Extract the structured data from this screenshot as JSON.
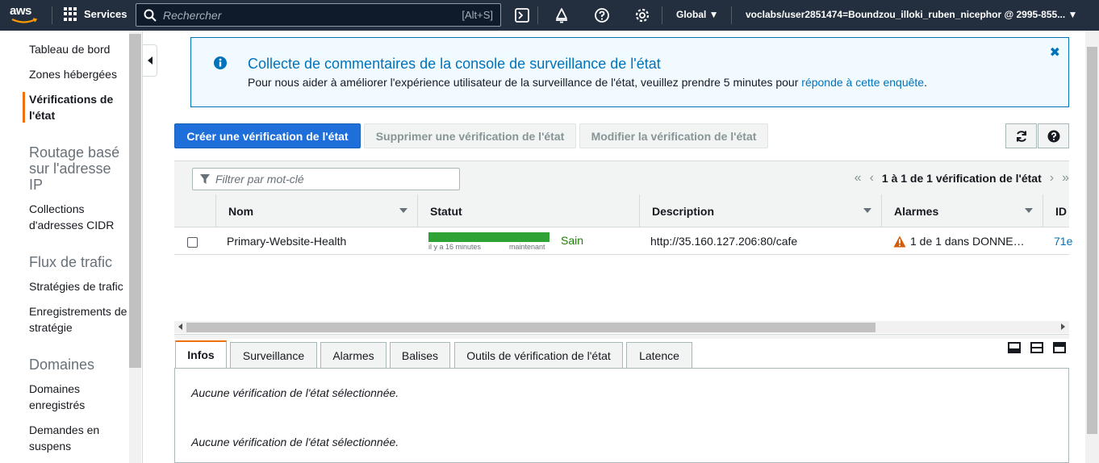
{
  "topnav": {
    "logo_text": "aws",
    "services_label": "Services",
    "search_placeholder": "Rechercher",
    "search_shortcut": "[Alt+S]",
    "region_label": "Global ▼",
    "account_label": "voclabs/user2851474=Boundzou_illoki_ruben_nicephor @ 2995-855... ▼"
  },
  "sidebar": {
    "items": [
      {
        "label": "Tableau de bord"
      },
      {
        "label": "Zones hébergées"
      },
      {
        "label": "Vérifications de l'état"
      },
      {
        "label": "Collections d'adresses CIDR"
      },
      {
        "label": "Stratégies de trafic"
      },
      {
        "label": "Enregistrements de stratégie"
      },
      {
        "label": "Domaines enregistrés"
      },
      {
        "label": "Demandes en suspens"
      }
    ],
    "headers": [
      {
        "label": "Routage basé sur l'adresse IP"
      },
      {
        "label": "Flux de trafic"
      },
      {
        "label": "Domaines"
      }
    ]
  },
  "banner": {
    "title": "Collecte de commentaires de la console de surveillance de l'état",
    "body": "Pour nous aider à améliorer l'expérience utilisateur de la surveillance de l'état, veuillez prendre 5 minutes pour ",
    "link": "réponde à cette enquête",
    "body_end": ".",
    "close": "✖"
  },
  "actions": {
    "create": "Créer une vérification de l'état",
    "delete": "Supprimer une vérification de l'état",
    "edit": "Modifier la vérification de l'état"
  },
  "table": {
    "filter_placeholder": "Filtrer par mot-clé",
    "pagination": "1 à 1 de 1 vérification de l'état",
    "columns": [
      "Nom",
      "Statut",
      "Description",
      "Alarmes",
      "ID"
    ],
    "rows": [
      {
        "name": "Primary-Website-Health",
        "status_from": "il y a 16 minutes",
        "status_to": "maintenant",
        "status": "Sain",
        "description": "http://35.160.127.206:80/cafe",
        "alarms": "1 de 1 dans DONNE…",
        "id": "71e"
      }
    ]
  },
  "details": {
    "tabs": [
      "Infos",
      "Surveillance",
      "Alarmes",
      "Balises",
      "Outils de vérification de l'état",
      "Latence"
    ],
    "message1": "Aucune vérification de l'état sélectionnée.",
    "message2": "Aucune vérification de l'état sélectionnée."
  },
  "colors": {
    "nav_bg": "#232f3e",
    "primary": "#1e6fd9",
    "accent": "#ec7211",
    "healthy": "#2ea234",
    "link": "#0073bb"
  }
}
